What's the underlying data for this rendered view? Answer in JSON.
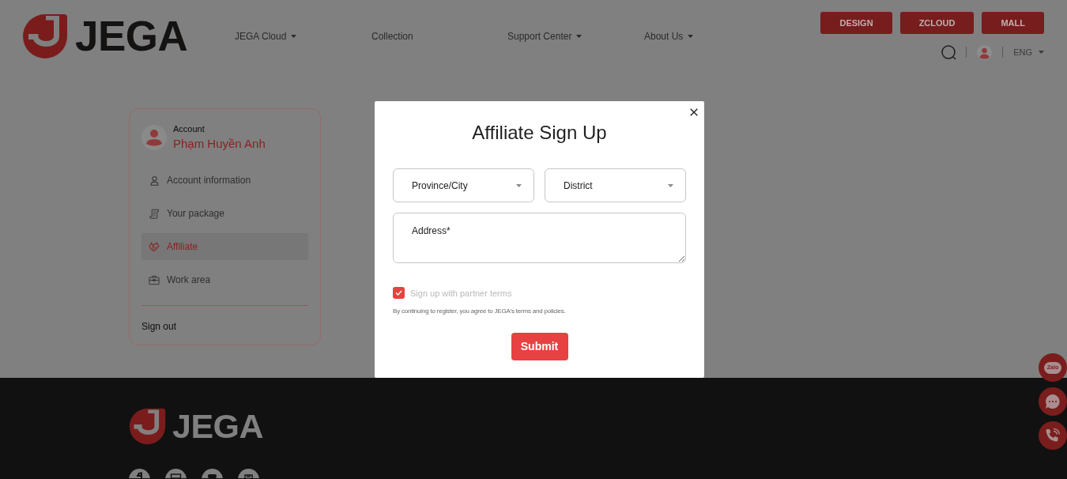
{
  "header": {
    "logo_text": "JEGA",
    "nav": [
      {
        "label": "JEGA Cloud",
        "dropdown": true
      },
      {
        "label": "Collection",
        "dropdown": false
      },
      {
        "label": "Support Center",
        "dropdown": true
      },
      {
        "label": "About Us",
        "dropdown": true
      }
    ],
    "buttons": [
      "DESIGN",
      "ZCLOUD",
      "MALL"
    ],
    "language": "ENG"
  },
  "sidebar": {
    "caption": "Account",
    "user_name": "Phạm Huyền Anh",
    "items": [
      {
        "kind": "person",
        "label": "Account information",
        "selected": false
      },
      {
        "kind": "document",
        "label": "Your package",
        "selected": false
      },
      {
        "kind": "handshake",
        "label": "Affiliate",
        "selected": true
      },
      {
        "kind": "briefcase",
        "label": "Work area",
        "selected": false
      }
    ],
    "sign_out": "Sign out"
  },
  "modal": {
    "title": "Affiliate Sign Up",
    "selects": [
      {
        "placeholder": "Province/City"
      },
      {
        "placeholder": "District"
      }
    ],
    "address": {
      "placeholder": "Address*"
    },
    "partner_terms": {
      "label": "Sign up with partner terms",
      "checked": true
    },
    "note": "By continuing to register, you agree to JEGA's terms and policies.",
    "submit": "Submit"
  },
  "footer": {
    "logo_text": "JEGA"
  },
  "floating_buttons": [
    {
      "kind": "zalo",
      "label": "Zalo"
    },
    {
      "kind": "chat"
    },
    {
      "kind": "phone"
    }
  ]
}
